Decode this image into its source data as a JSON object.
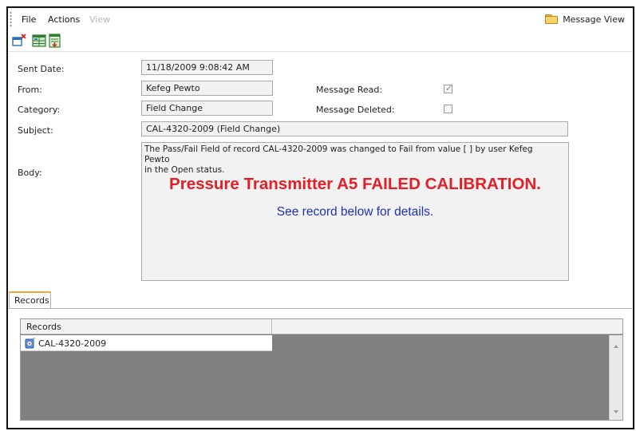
{
  "menu": {
    "file": "File",
    "actions": "Actions",
    "view": "View"
  },
  "window": {
    "title": "Message View",
    "title_icon": "folder-icon"
  },
  "toolbar": {
    "icons": [
      "new-message-icon",
      "grid-view-icon",
      "export-icon"
    ]
  },
  "form": {
    "sent_date_label": "Sent Date:",
    "sent_date_value": "11/18/2009 9:08:42 AM",
    "from_label": "From:",
    "from_value": "Kefeg Pewto",
    "category_label": "Category:",
    "category_value": "Field Change",
    "subject_label": "Subject:",
    "subject_value": "CAL-4320-2009 (Field Change)",
    "body_label": "Body:",
    "message_read_label": "Message Read:",
    "message_read_checked": true,
    "message_deleted_label": "Message Deleted:",
    "message_deleted_checked": false
  },
  "body": {
    "intro_line1": "The Pass/Fail Field of record CAL-4320-2009 was changed to Fail from value [ ] by user Kefeg Pewto",
    "intro_line2": "in the Open status.",
    "alert": "Pressure Transmitter A5 FAILED CALIBRATION.",
    "alert_color": "#e21f26",
    "sub": "See record below for details.",
    "sub_color": "#2030b8"
  },
  "tabs": {
    "records": "Records"
  },
  "records": {
    "column_header": "Records",
    "rows": [
      {
        "label": "CAL-4320-2009",
        "icon": "record-icon"
      }
    ]
  },
  "colors": {
    "accent_tab": "#f0a830",
    "field_bg": "#f2f2f2",
    "grid_bg": "#808080"
  }
}
